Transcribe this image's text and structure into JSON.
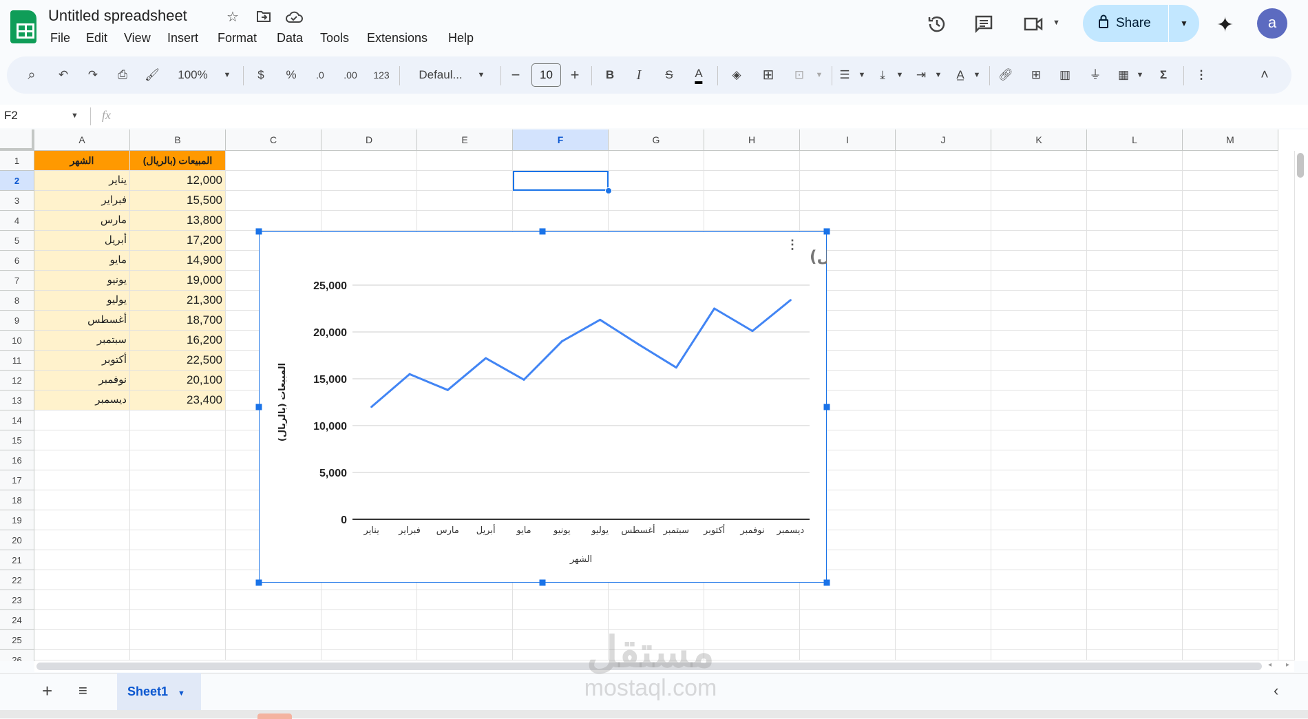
{
  "app": {
    "title": "Untitled spreadsheet",
    "share_label": "Share",
    "avatar_letter": "a"
  },
  "menu": [
    "File",
    "Edit",
    "View",
    "Insert",
    "Format",
    "Data",
    "Tools",
    "Extensions",
    "Help"
  ],
  "toolbar": {
    "zoom": "100%",
    "currency": "$",
    "percent": "%",
    "dec_decrease": ".0",
    "dec_increase": ".00",
    "number_format": "123",
    "font": "Defaul...",
    "font_size": "10",
    "bold": "B",
    "italic": "I",
    "sum": "Σ"
  },
  "formula_bar": {
    "name_box": "F2",
    "fx": "fx",
    "value": ""
  },
  "columns": [
    "A",
    "B",
    "C",
    "D",
    "E",
    "F",
    "G",
    "H",
    "I",
    "J",
    "K",
    "L",
    "M"
  ],
  "rows": [
    "1",
    "2",
    "3",
    "4",
    "5",
    "6",
    "7",
    "8",
    "9",
    "10",
    "11",
    "12",
    "13",
    "14",
    "15",
    "16",
    "17",
    "18",
    "19",
    "20",
    "21",
    "22",
    "23",
    "24",
    "25",
    "26"
  ],
  "selected_cell": "F2",
  "colors": {
    "header_fill": "#ff9900",
    "data_fill": "#fff2cc",
    "accent": "#1a73e8",
    "line": "#4285f4"
  },
  "table": {
    "headers": [
      "الشهر",
      "المبيعات (بالريال)"
    ],
    "rows": [
      [
        "يناير",
        "12,000"
      ],
      [
        "فبراير",
        "15,500"
      ],
      [
        "مارس",
        "13,800"
      ],
      [
        "أبريل",
        "17,200"
      ],
      [
        "مايو",
        "14,900"
      ],
      [
        "يونيو",
        "19,000"
      ],
      [
        "يوليو",
        "21,300"
      ],
      [
        "أغسطس",
        "18,700"
      ],
      [
        "سبتمبر",
        "16,200"
      ],
      [
        "أكتوبر",
        "22,500"
      ],
      [
        "نوفمبر",
        "20,100"
      ],
      [
        "ديسمبر",
        "23,400"
      ]
    ]
  },
  "chart_data": {
    "type": "line",
    "title": "الشهر vs. المبيعات (بالريال)",
    "xlabel": "الشهر",
    "ylabel": "المبيعات (بالريال)",
    "categories": [
      "يناير",
      "فبراير",
      "مارس",
      "أبريل",
      "مايو",
      "يونيو",
      "يوليو",
      "أغسطس",
      "سبتمبر",
      "أكتوبر",
      "نوفمبر",
      "ديسمبر"
    ],
    "values": [
      12000,
      15500,
      13800,
      17200,
      14900,
      19000,
      21300,
      18700,
      16200,
      22500,
      20100,
      23400
    ],
    "ylim": [
      0,
      25000
    ],
    "yticks": [
      "0",
      "5,000",
      "10,000",
      "15,000",
      "20,000",
      "25,000"
    ],
    "grid": true,
    "legend": "none"
  },
  "sheet_tabs": [
    {
      "label": "Sheet1",
      "active": true
    }
  ],
  "watermark": {
    "arabic": "مستقل",
    "latin": "mostaql.com"
  }
}
